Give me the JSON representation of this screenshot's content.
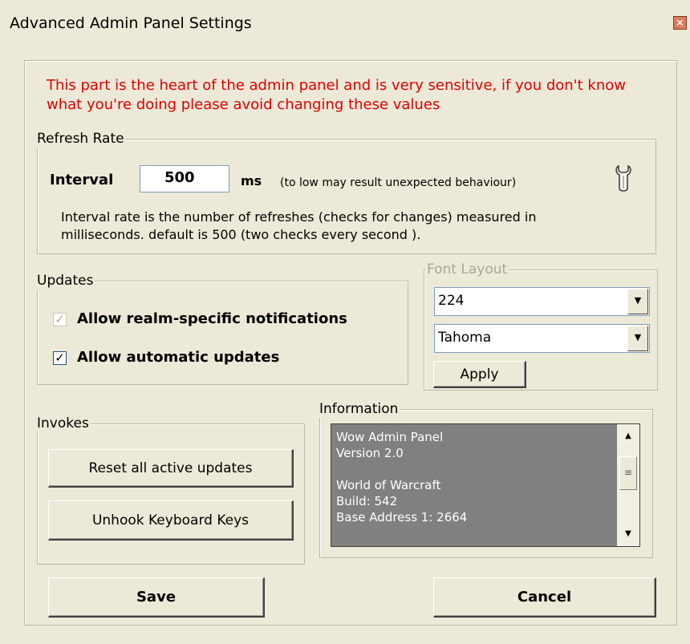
{
  "window": {
    "title": "Advanced Admin Panel Settings"
  },
  "warning": "This part is the heart of the admin panel and is very sensitive, if you don't know what you're doing please avoid changing these values",
  "refresh": {
    "legend": "Refresh Rate",
    "interval_label": "Interval",
    "interval_value": "500",
    "unit": "ms",
    "hint": "(to low may result unexpected behaviour)",
    "description_line1": "Interval rate is the number of refreshes (checks for changes) measured in",
    "description_line2": "milliseconds. default is 500 (two checks every second )."
  },
  "updates": {
    "legend": "Updates",
    "options": [
      {
        "label": "Allow realm-specific notifications",
        "checked": true,
        "disabled": true
      },
      {
        "label": "Allow automatic updates",
        "checked": true,
        "disabled": false
      }
    ]
  },
  "font_layout": {
    "legend": "Font Layout",
    "size_value": "224",
    "font_value": "Tahoma",
    "apply_label": "Apply"
  },
  "invokes": {
    "legend": "Invokes",
    "reset_label": "Reset all active updates",
    "unhook_label": "Unhook Keyboard Keys"
  },
  "information": {
    "legend": "Information",
    "lines": [
      "Wow Admin Panel",
      "Version 2.0",
      "",
      "World of Warcraft",
      "Build: 542",
      "Base Address 1: 2664"
    ]
  },
  "footer": {
    "save_label": "Save",
    "cancel_label": "Cancel"
  },
  "icons": {
    "close": "close-icon",
    "wrench": "wrench-icon"
  }
}
